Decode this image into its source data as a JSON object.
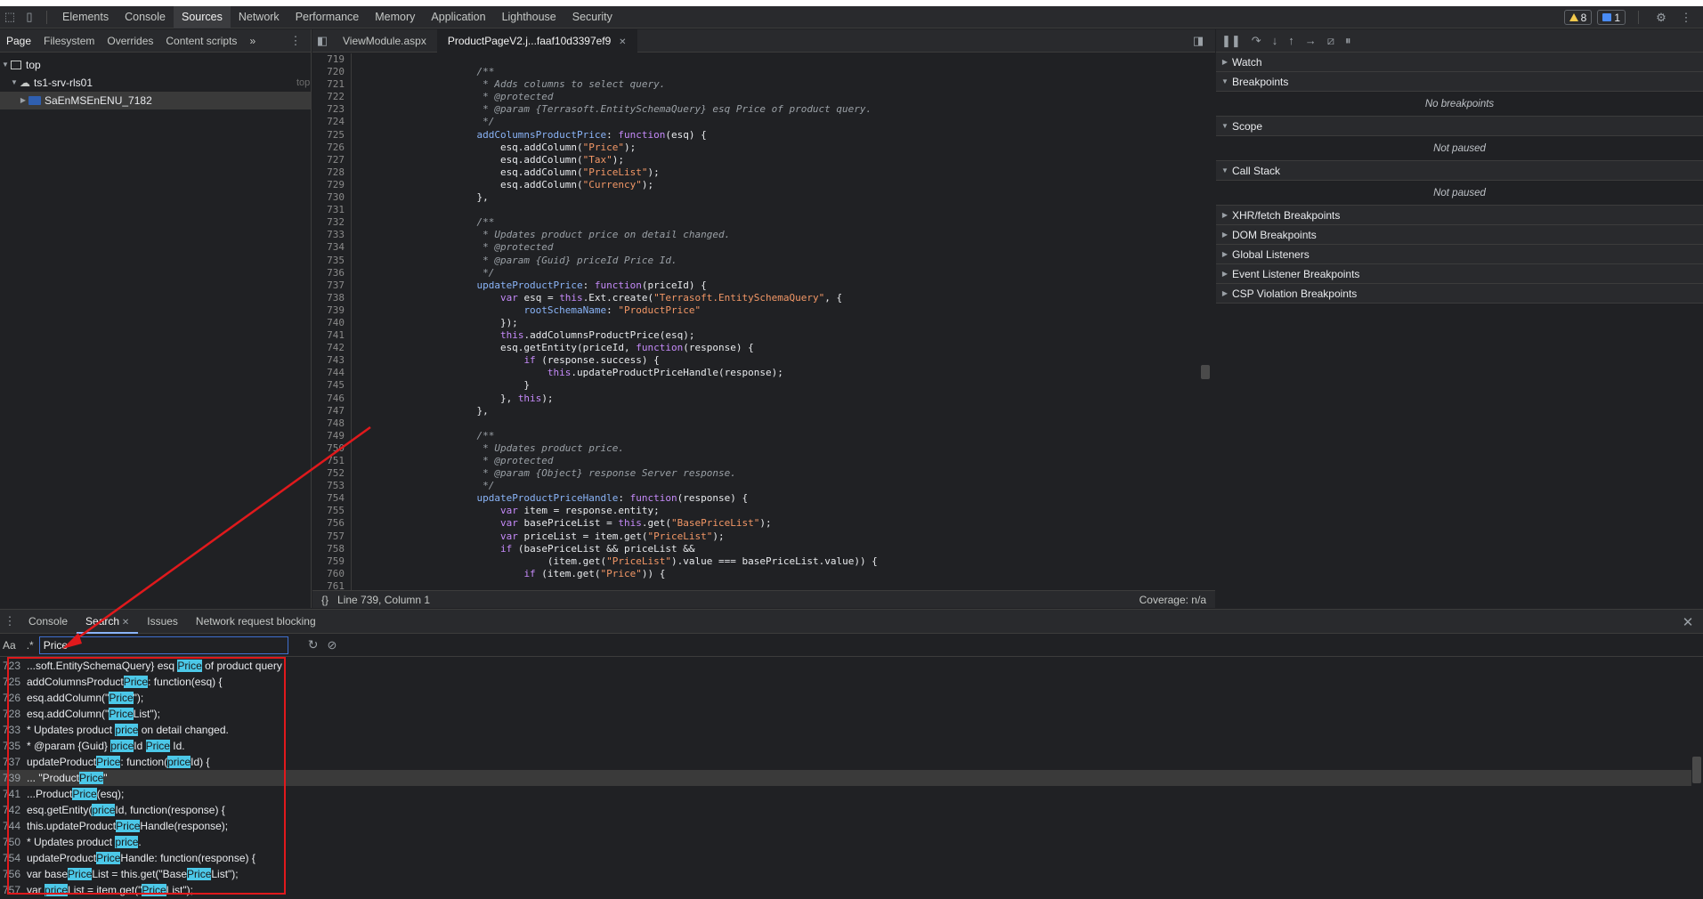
{
  "toolbar": {
    "tabs": [
      "Elements",
      "Console",
      "Sources",
      "Network",
      "Performance",
      "Memory",
      "Application",
      "Lighthouse",
      "Security"
    ],
    "active_tab": "Sources",
    "warnings_count": "8",
    "messages_count": "1"
  },
  "navigator": {
    "tabs": [
      "Page",
      "Filesystem",
      "Overrides",
      "Content scripts"
    ],
    "active_tab": "Page",
    "more": "»",
    "tree": {
      "top": "top",
      "origin": "ts1-srv-rls01",
      "folder": "SaEnMSEnENU_7182",
      "hint": "top"
    }
  },
  "editor": {
    "tabs": [
      "ViewModule.aspx",
      "ProductPageV2.j...faaf10d3397ef9"
    ],
    "active_tab": "ProductPageV2.j...faaf10d3397ef9",
    "status": "Line 739, Column 1",
    "coverage": "Coverage: n/a",
    "braces": "{}",
    "lines": [
      {
        "n": "719",
        "t": ""
      },
      {
        "n": "720",
        "t": "                    /**"
      },
      {
        "n": "721",
        "t": "                     * Adds columns to select query."
      },
      {
        "n": "722",
        "t": "                     * @protected"
      },
      {
        "n": "723",
        "t": "                     * @param {Terrasoft.EntitySchemaQuery} esq Price of product query."
      },
      {
        "n": "724",
        "t": "                     */"
      },
      {
        "n": "725",
        "t": "                    addColumnsProductPrice: function(esq) {"
      },
      {
        "n": "726",
        "t": "                        esq.addColumn(\"Price\");"
      },
      {
        "n": "727",
        "t": "                        esq.addColumn(\"Tax\");"
      },
      {
        "n": "728",
        "t": "                        esq.addColumn(\"PriceList\");"
      },
      {
        "n": "729",
        "t": "                        esq.addColumn(\"Currency\");"
      },
      {
        "n": "730",
        "t": "                    },"
      },
      {
        "n": "731",
        "t": ""
      },
      {
        "n": "732",
        "t": "                    /**"
      },
      {
        "n": "733",
        "t": "                     * Updates product price on detail changed."
      },
      {
        "n": "734",
        "t": "                     * @protected"
      },
      {
        "n": "735",
        "t": "                     * @param {Guid} priceId Price Id."
      },
      {
        "n": "736",
        "t": "                     */"
      },
      {
        "n": "737",
        "t": "                    updateProductPrice: function(priceId) {"
      },
      {
        "n": "738",
        "t": "                        var esq = this.Ext.create(\"Terrasoft.EntitySchemaQuery\", {"
      },
      {
        "n": "739",
        "t": "                            rootSchemaName: \"ProductPrice\""
      },
      {
        "n": "740",
        "t": "                        });"
      },
      {
        "n": "741",
        "t": "                        this.addColumnsProductPrice(esq);"
      },
      {
        "n": "742",
        "t": "                        esq.getEntity(priceId, function(response) {"
      },
      {
        "n": "743",
        "t": "                            if (response.success) {"
      },
      {
        "n": "744",
        "t": "                                this.updateProductPriceHandle(response);"
      },
      {
        "n": "745",
        "t": "                            }"
      },
      {
        "n": "746",
        "t": "                        }, this);"
      },
      {
        "n": "747",
        "t": "                    },"
      },
      {
        "n": "748",
        "t": ""
      },
      {
        "n": "749",
        "t": "                    /**"
      },
      {
        "n": "750",
        "t": "                     * Updates product price."
      },
      {
        "n": "751",
        "t": "                     * @protected"
      },
      {
        "n": "752",
        "t": "                     * @param {Object} response Server response."
      },
      {
        "n": "753",
        "t": "                     */"
      },
      {
        "n": "754",
        "t": "                    updateProductPriceHandle: function(response) {"
      },
      {
        "n": "755",
        "t": "                        var item = response.entity;"
      },
      {
        "n": "756",
        "t": "                        var basePriceList = this.get(\"BasePriceList\");"
      },
      {
        "n": "757",
        "t": "                        var priceList = item.get(\"PriceList\");"
      },
      {
        "n": "758",
        "t": "                        if (basePriceList && priceList &&"
      },
      {
        "n": "759",
        "t": "                                (item.get(\"PriceList\").value === basePriceList.value)) {"
      },
      {
        "n": "760",
        "t": "                            if (item.get(\"Price\")) {"
      },
      {
        "n": "761",
        "t": ""
      }
    ]
  },
  "debugger": {
    "sections": [
      {
        "title": "Watch",
        "body": ""
      },
      {
        "title": "Breakpoints",
        "body": "No breakpoints"
      },
      {
        "title": "Scope",
        "body": "Not paused"
      },
      {
        "title": "Call Stack",
        "body": "Not paused"
      },
      {
        "title": "XHR/fetch Breakpoints",
        "body": ""
      },
      {
        "title": "DOM Breakpoints",
        "body": ""
      },
      {
        "title": "Global Listeners",
        "body": ""
      },
      {
        "title": "Event Listener Breakpoints",
        "body": ""
      },
      {
        "title": "CSP Violation Breakpoints",
        "body": ""
      }
    ]
  },
  "drawer": {
    "tabs": [
      "Console",
      "Search",
      "Issues",
      "Network request blocking"
    ],
    "active_tab": "Search",
    "case_label": "Aa",
    "regex_label": ".*",
    "search_value": "Price",
    "results": [
      {
        "n": "723",
        "parts": [
          [
            "...soft.EntitySchemaQuery} esq ",
            0
          ],
          [
            "Price",
            1
          ],
          [
            " of product query",
            0
          ]
        ]
      },
      {
        "n": "725",
        "parts": [
          [
            "addColumnsProduct",
            0
          ],
          [
            "Price",
            1
          ],
          [
            ": function(esq) {",
            0
          ]
        ]
      },
      {
        "n": "726",
        "parts": [
          [
            "esq.addColumn(\"",
            0
          ],
          [
            "Price",
            1
          ],
          [
            "\");",
            0
          ]
        ]
      },
      {
        "n": "728",
        "parts": [
          [
            "esq.addColumn(\"",
            0
          ],
          [
            "Price",
            1
          ],
          [
            "List\");",
            0
          ]
        ]
      },
      {
        "n": "733",
        "parts": [
          [
            "* Updates product ",
            0
          ],
          [
            "price",
            1
          ],
          [
            " on detail changed.",
            0
          ]
        ]
      },
      {
        "n": "735",
        "parts": [
          [
            "* @param {Guid} ",
            0
          ],
          [
            "price",
            1
          ],
          [
            "Id ",
            0
          ],
          [
            "Price",
            1
          ],
          [
            " Id.",
            0
          ]
        ]
      },
      {
        "n": "737",
        "parts": [
          [
            "updateProduct",
            0
          ],
          [
            "Price",
            1
          ],
          [
            ": function(",
            0
          ],
          [
            "price",
            1
          ],
          [
            "Id) {",
            0
          ]
        ]
      },
      {
        "n": "739",
        "parts": [
          [
            "... \"Product",
            0
          ],
          [
            "Price",
            1
          ],
          [
            "\"",
            0
          ]
        ]
      },
      {
        "n": "741",
        "parts": [
          [
            "...Product",
            0
          ],
          [
            "Price",
            1
          ],
          [
            "(esq);",
            0
          ]
        ]
      },
      {
        "n": "742",
        "parts": [
          [
            "esq.getEntity(",
            0
          ],
          [
            "price",
            1
          ],
          [
            "Id, function(response) {",
            0
          ]
        ]
      },
      {
        "n": "744",
        "parts": [
          [
            "this.updateProduct",
            0
          ],
          [
            "Price",
            1
          ],
          [
            "Handle(response);",
            0
          ]
        ]
      },
      {
        "n": "750",
        "parts": [
          [
            "* Updates product ",
            0
          ],
          [
            "price",
            1
          ],
          [
            ".",
            0
          ]
        ]
      },
      {
        "n": "754",
        "parts": [
          [
            "updateProduct",
            0
          ],
          [
            "Price",
            1
          ],
          [
            "Handle: function(response) {",
            0
          ]
        ]
      },
      {
        "n": "756",
        "parts": [
          [
            "var base",
            0
          ],
          [
            "Price",
            1
          ],
          [
            "List = this.get(\"Base",
            0
          ],
          [
            "Price",
            1
          ],
          [
            "List\");",
            0
          ]
        ]
      },
      {
        "n": "757",
        "parts": [
          [
            "var ",
            0
          ],
          [
            "price",
            1
          ],
          [
            "List = item.get(\"",
            0
          ],
          [
            "Price",
            1
          ],
          [
            "List\");",
            0
          ]
        ]
      }
    ]
  }
}
